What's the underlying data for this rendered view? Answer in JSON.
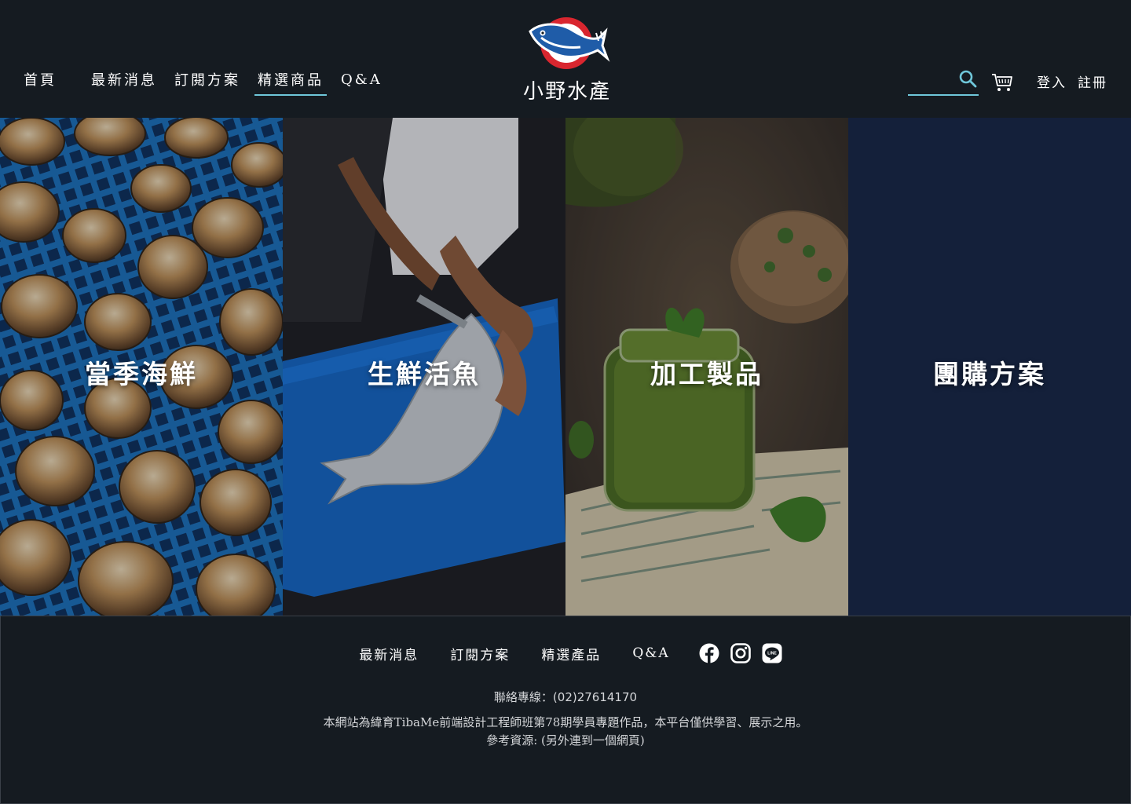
{
  "header": {
    "nav": [
      {
        "id": "home",
        "label": "首頁"
      },
      {
        "id": "news",
        "label": "最新消息"
      },
      {
        "id": "subscription",
        "label": "訂閱方案"
      },
      {
        "id": "products",
        "label": "精選商品"
      },
      {
        "id": "qa",
        "label": "Q&A"
      }
    ],
    "active_nav": "精選商品",
    "logo_text": "小野水產",
    "search": {
      "placeholder": "",
      "icon": "search-icon"
    },
    "cart_icon": "cart-icon",
    "login_label": "登入",
    "register_label": "註冊",
    "accent_color": "#6fc7da"
  },
  "categories": [
    {
      "label": "當季海鮮",
      "image": "clams-on-blue-crate"
    },
    {
      "label": "生鮮活魚",
      "image": "fish-on-blue-cutting-board"
    },
    {
      "label": "加工製品",
      "image": "pesto-jar"
    },
    {
      "label": "團購方案",
      "image": "",
      "background": "#14203a"
    }
  ],
  "footer": {
    "nav": [
      {
        "label": "最新消息"
      },
      {
        "label": "訂閱方案"
      },
      {
        "label": "精選產品"
      },
      {
        "label": "Q&A"
      }
    ],
    "social": [
      "facebook-icon",
      "instagram-icon",
      "line-icon"
    ],
    "contact": "聯絡專線：(02)27614170",
    "disclaimer": "本網站為緯育TibaMe前端設計工程師班第78期學員專題作品，本平台僅供學習、展示之用。",
    "reference": "參考資源: (另外連到一個網頁)"
  },
  "colors": {
    "background": "#151b21",
    "panel_navy": "#14203a",
    "logo_red": "#d9262f",
    "logo_blue": "#1f5ca8"
  }
}
